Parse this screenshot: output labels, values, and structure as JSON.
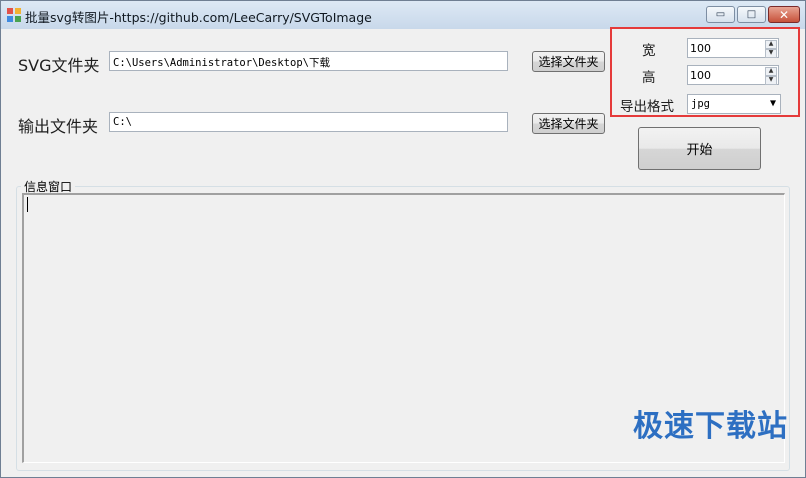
{
  "window": {
    "title": "批量svg转图片-https://github.com/LeeCarry/SVGToImage",
    "controls": {
      "minimize": "▭",
      "maximize": "□",
      "close": "✕"
    }
  },
  "form": {
    "svg_folder_label": "SVG文件夹",
    "svg_folder_value": "C:\\Users\\Administrator\\Desktop\\下载",
    "svg_browse_label": "选择文件夹",
    "output_folder_label": "输出文件夹",
    "output_folder_value": "C:\\",
    "output_browse_label": "选择文件夹"
  },
  "settings": {
    "width_label": "宽",
    "width_value": "100",
    "height_label": "高",
    "height_value": "100",
    "format_label": "导出格式",
    "format_value": "jpg",
    "start_label": "开始",
    "highlight_color": "#e53a3a"
  },
  "log": {
    "title": "信息窗口",
    "content": ""
  },
  "watermark": {
    "text": "极速下载站"
  }
}
